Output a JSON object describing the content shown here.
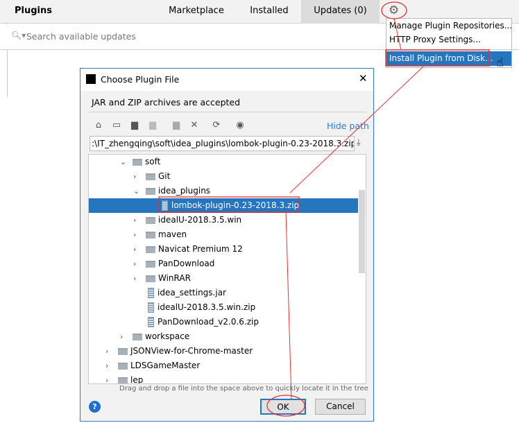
{
  "header": {
    "title": "Plugins",
    "tabs": [
      {
        "label": "Marketplace"
      },
      {
        "label": "Installed"
      },
      {
        "label": "Updates (0)",
        "active": true
      }
    ],
    "settings_icon": "gear-icon"
  },
  "search": {
    "placeholder": "Search available updates"
  },
  "menu": {
    "items": [
      "Manage Plugin Repositories...",
      "HTTP Proxy Settings...",
      "Install Plugin from Disk..."
    ],
    "highlighted": 2
  },
  "dialog": {
    "title": "Choose Plugin File",
    "subtitle": "JAR and ZIP archives are accepted",
    "hide_path": "Hide path",
    "path": ":\\IT_zhengqing\\soft\\idea_plugins\\lombok-plugin-0.23-2018.3.zip",
    "tree": [
      {
        "label": "soft",
        "level": 2,
        "type": "folder",
        "expanded": true
      },
      {
        "label": "Git",
        "level": 3,
        "type": "folder"
      },
      {
        "label": "idea_plugins",
        "level": 3,
        "type": "folder",
        "expanded": true
      },
      {
        "label": "lombok-plugin-0.23-2018.3.zip",
        "level": 4,
        "type": "zip",
        "selected": true
      },
      {
        "label": "idealU-2018.3.5.win",
        "level": 3,
        "type": "folder"
      },
      {
        "label": "maven",
        "level": 3,
        "type": "folder"
      },
      {
        "label": "Navicat Premium 12",
        "level": 3,
        "type": "folder"
      },
      {
        "label": "PanDownload",
        "level": 3,
        "type": "folder"
      },
      {
        "label": "WinRAR",
        "level": 3,
        "type": "folder"
      },
      {
        "label": "idea_settings.jar",
        "level": 3,
        "type": "zip"
      },
      {
        "label": "idealU-2018.3.5.win.zip",
        "level": 3,
        "type": "zip"
      },
      {
        "label": "PanDownload_v2.0.6.zip",
        "level": 3,
        "type": "zip"
      },
      {
        "label": "workspace",
        "level": 2,
        "type": "folder"
      },
      {
        "label": "JSONView-for-Chrome-master",
        "level": 1,
        "type": "folder"
      },
      {
        "label": "LDSGameMaster",
        "level": 1,
        "type": "folder"
      },
      {
        "label": "lep",
        "level": 1,
        "type": "folder"
      }
    ],
    "hint": "Drag and drop a file into the space above to quickly locate it in the tree",
    "ok": "OK",
    "cancel": "Cancel"
  },
  "colors": {
    "accent": "#2675bf",
    "annotation": "#e8312f",
    "link": "#2a7bd5"
  }
}
